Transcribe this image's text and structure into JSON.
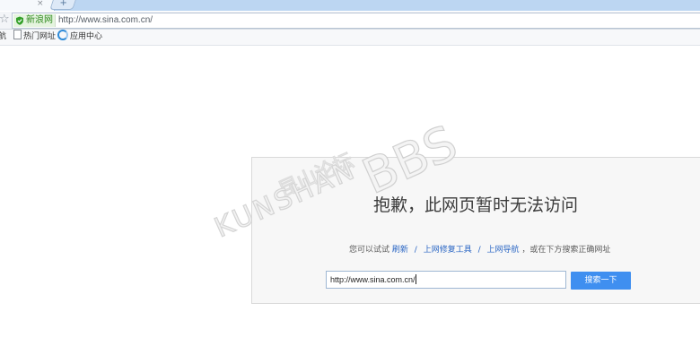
{
  "tab": {
    "close_glyph": "×",
    "newtab_glyph": "+"
  },
  "address_bar": {
    "site_badge": "新浪网",
    "url": "http://www.sina.com.cn/"
  },
  "bookmarks": [
    {
      "label": "航",
      "icon": ""
    },
    {
      "label": "热门网址",
      "icon": "doc-icon"
    },
    {
      "label": "应用中心",
      "icon": "app-icon"
    }
  ],
  "error_page": {
    "title": "抱歉，此网页暂时无法访问",
    "hint_prefix": "您可以试试",
    "links": [
      "刷新",
      "上网修复工具",
      "上网导航"
    ],
    "separator": "/",
    "hint_suffix": "，或在下方搜索正确网址",
    "search_value": "http://www.sina.com.cn/",
    "search_button": "搜索一下"
  },
  "watermark": {
    "line1": "昆山论坛",
    "line2": "KUNSHAN",
    "line3": "BBS"
  },
  "colors": {
    "accent": "#3f8ff0",
    "link": "#2a66c4",
    "badge_green": "#2f8a1f"
  }
}
